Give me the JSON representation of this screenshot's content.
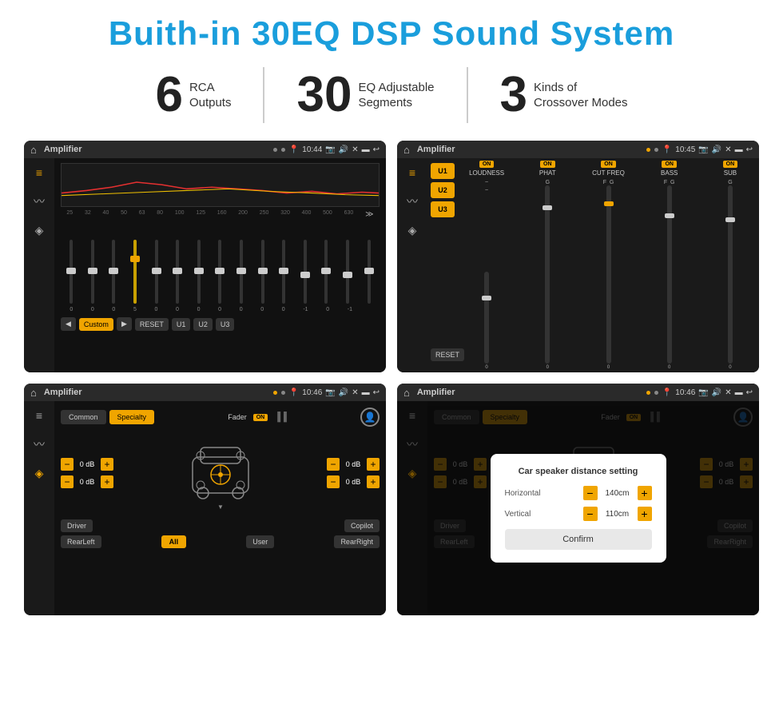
{
  "header": {
    "title": "Buith-in 30EQ DSP Sound System"
  },
  "stats": [
    {
      "number": "6",
      "label": "RCA\nOutputs"
    },
    {
      "number": "30",
      "label": "EQ Adjustable\nSegments"
    },
    {
      "number": "3",
      "label": "Kinds of\nCrossover Modes"
    }
  ],
  "screens": [
    {
      "id": "screen1",
      "status_app": "Amplifier",
      "status_time": "10:44",
      "description": "EQ Equalizer screen"
    },
    {
      "id": "screen2",
      "status_app": "Amplifier",
      "status_time": "10:45",
      "description": "Crossover channels screen"
    },
    {
      "id": "screen3",
      "status_app": "Amplifier",
      "status_time": "10:46",
      "description": "Speaker fader screen"
    },
    {
      "id": "screen4",
      "status_app": "Amplifier",
      "status_time": "10:46",
      "description": "Car speaker distance setting dialog"
    }
  ],
  "screen1": {
    "eq_freqs": [
      "25",
      "32",
      "40",
      "50",
      "63",
      "80",
      "100",
      "125",
      "160",
      "200",
      "250",
      "320",
      "400",
      "500",
      "630"
    ],
    "eq_values": [
      "0",
      "0",
      "0",
      "5",
      "0",
      "0",
      "0",
      "0",
      "0",
      "0",
      "0",
      "-1",
      "0",
      "-1",
      ""
    ],
    "preset_label": "Custom",
    "buttons": [
      "◀",
      "Custom",
      "▶",
      "RESET",
      "U1",
      "U2",
      "U3"
    ]
  },
  "screen2": {
    "u_buttons": [
      "U1",
      "U2",
      "U3"
    ],
    "channels": [
      {
        "on": true,
        "label": "LOUDNESS"
      },
      {
        "on": true,
        "label": "PHAT"
      },
      {
        "on": true,
        "label": "CUT FREQ"
      },
      {
        "on": true,
        "label": "BASS"
      },
      {
        "on": true,
        "label": "SUB"
      }
    ],
    "reset_label": "RESET"
  },
  "screen3": {
    "tab_common": "Common",
    "tab_specialty": "Specialty",
    "fader_label": "Fader",
    "fader_on": "ON",
    "db_values": [
      "0 dB",
      "0 dB",
      "0 dB",
      "0 dB"
    ],
    "labels": [
      "Driver",
      "RearLeft",
      "All",
      "User",
      "RearRight",
      "Copilot"
    ]
  },
  "screen4": {
    "dialog_title": "Car speaker distance setting",
    "horizontal_label": "Horizontal",
    "horizontal_value": "140cm",
    "vertical_label": "Vertical",
    "vertical_value": "110cm",
    "confirm_label": "Confirm",
    "db_values": [
      "0 dB",
      "0 dB"
    ],
    "labels": [
      "Driver",
      "RearLeft",
      "All",
      "User",
      "RearRight",
      "Copilot"
    ]
  }
}
